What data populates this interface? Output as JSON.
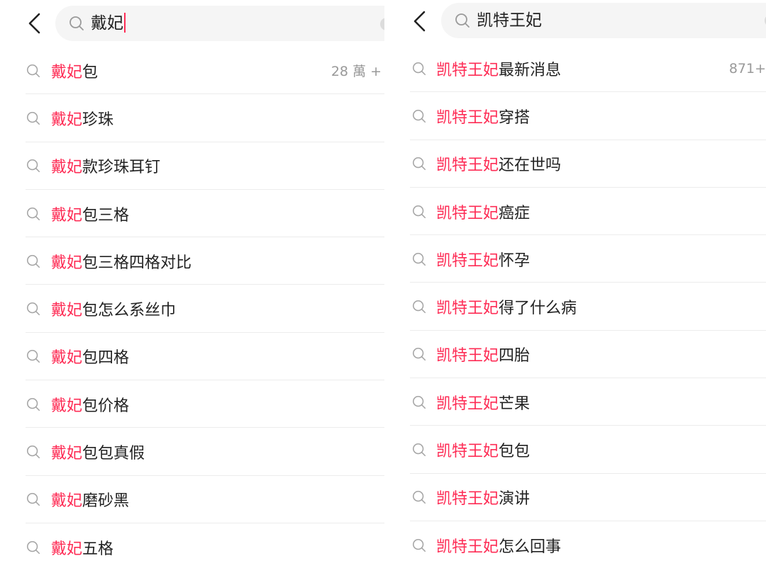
{
  "colors": {
    "highlight": "#fe2c55",
    "text": "#222222",
    "muted": "#999999",
    "search_bg": "#f5f5f5"
  },
  "icons": {
    "back": "chevron-left-icon",
    "search": "search-icon",
    "suggestion": "search-icon",
    "clear": "clear-icon"
  },
  "left": {
    "query": "戴妃",
    "items": [
      {
        "hl": "戴妃",
        "rest": "包",
        "count": "28 萬 +"
      },
      {
        "hl": "戴妃",
        "rest": "珍珠"
      },
      {
        "hl": "戴妃",
        "rest": "款珍珠耳钉"
      },
      {
        "hl": "戴妃",
        "rest": "包三格"
      },
      {
        "hl": "戴妃",
        "rest": "包三格四格对比"
      },
      {
        "hl": "戴妃",
        "rest": "包怎么系丝巾"
      },
      {
        "hl": "戴妃",
        "rest": "包四格"
      },
      {
        "hl": "戴妃",
        "rest": "包价格"
      },
      {
        "hl": "戴妃",
        "rest": "包包真假"
      },
      {
        "hl": "戴妃",
        "rest": "磨砂黑"
      },
      {
        "hl": "戴妃",
        "rest": "五格"
      }
    ]
  },
  "right": {
    "query": "凯特王妃",
    "items": [
      {
        "hl": "凯特王妃",
        "rest": "最新消息",
        "count": "871+"
      },
      {
        "hl": "凯特王妃",
        "rest": "穿搭"
      },
      {
        "hl": "凯特王妃",
        "rest": "还在世吗"
      },
      {
        "hl": "凯特王妃",
        "rest": "癌症"
      },
      {
        "hl": "凯特王妃",
        "rest": "怀孕"
      },
      {
        "hl": "凯特王妃",
        "rest": "得了什么病"
      },
      {
        "hl": "凯特王妃",
        "rest": "四胎"
      },
      {
        "hl": "凯特王妃",
        "rest": "芒果"
      },
      {
        "hl": "凯特王妃",
        "rest": "包包"
      },
      {
        "hl": "凯特王妃",
        "rest": "演讲"
      },
      {
        "hl": "凯特王妃",
        "rest": "怎么回事"
      }
    ]
  }
}
